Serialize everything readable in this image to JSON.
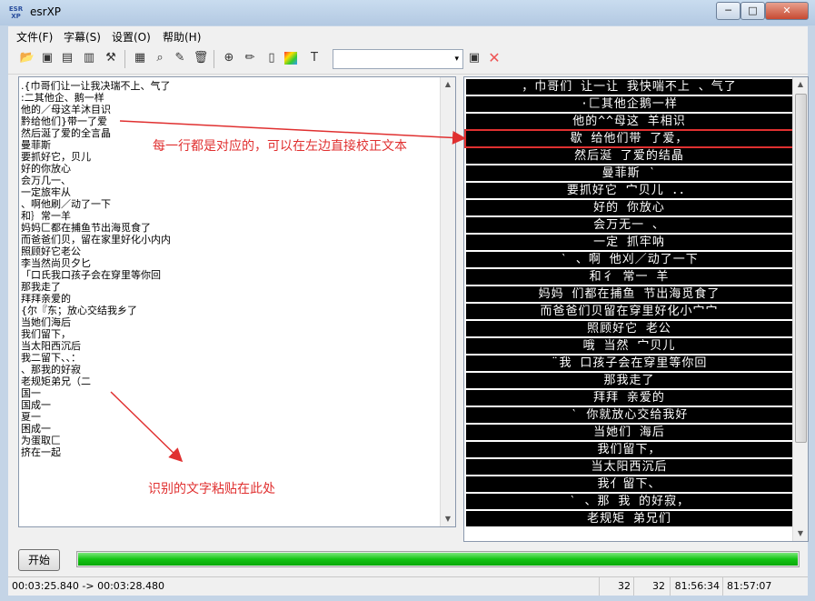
{
  "window": {
    "title": "esrXP",
    "icon_text": "ESR XP"
  },
  "window_buttons": {
    "minimize": "─",
    "maximize": "□",
    "close": "✕"
  },
  "menu": [
    "文件(F)",
    "字幕(S)",
    "设置(O)",
    "帮助(H)"
  ],
  "toolbar": {
    "icons": [
      "open-icon",
      "save-icon",
      "save-as-icon",
      "export-icon",
      "tools-icon",
      "film-icon",
      "find-icon",
      "edit-icon",
      "trash-icon",
      "zoom-icon",
      "pencil-icon",
      "document-icon",
      "color-icon",
      "text-icon"
    ],
    "combo_value": "",
    "combo_arrow": "▾"
  },
  "editor_text": ".{巾哥们让一让我决瑞不上、气了\n:二其他企、鹅一样\n他的／母这羊沐目识\n黔给他们}带一了爱\n然后涎了爱的全言晶\n曼菲斯\n要抓好它，贝儿\n好的你放心\n会万几一、\n一定旅牢从\n、啊他刷／动了一下\n和｝常一羊\n妈妈匚都在捕鱼节出海觅食了\n而爸爸们贝，留在家里好化小内内\n照顾好它老公\n李当然尚贝夕匕\n「口氏我口孩子会在穿里等你回\n那我走了\n拜拜亲爱的\n{尔『东；放心交结我乡了\n当她们海后\n我们留下，\n当太阳西沉后\n我二留下、、：\n、那我的好寂\n老规矩弟兄（二\n国一\n国成一\n夏一\n困成一\n为蛋取匚\n挤在一起",
  "subtitle_rows": [
    "，巾哥们 让一让 我快喘不上 、气了",
    "·匚其他企鹅一样",
    "他的^^母这 羊相识",
    "歇  给他们带 了爱，",
    "然后涎  了爱的结晶",
    "曼菲斯         ‵",
    "要抓好它 宀贝儿    ．．",
    "好的  你放心",
    "会万无一  、",
    "一定  抓牢呐",
    "‵  、啊  他刈／动了一下",
    "和彳 常一 羊",
    "妈妈 们都在捕鱼  节出海觅食了",
    "而爸爸们贝留在穿里好化小宀宀",
    "照顾好它 老公",
    "哦 当然  宀贝儿",
    "¨我 口孩子会在穿里等你回",
    "那我走了",
    "拜拜  亲爱的",
    "‵     你就放心交给我好",
    "当她们   海后",
    "我们留下，",
    "当太阳西沉后",
    "我亻留下、",
    "‵  、那 我   的好寂，",
    "老规矩  弟兄们"
  ],
  "selected_row": 3,
  "annotations": {
    "top": "每一行都是对应的，可以在左边直接校正文本",
    "bottom": "识别的文字粘贴在此处"
  },
  "start_button": "开始",
  "progress_percent": 100,
  "status": {
    "time_range": "00:03:25.840 -> 00:03:28.480",
    "count_a": "32",
    "count_b": "32",
    "time_a": "81:56:34",
    "time_b": "81:57:07"
  },
  "colors": {
    "annotation": "#e03030",
    "progress": "#14c414"
  }
}
